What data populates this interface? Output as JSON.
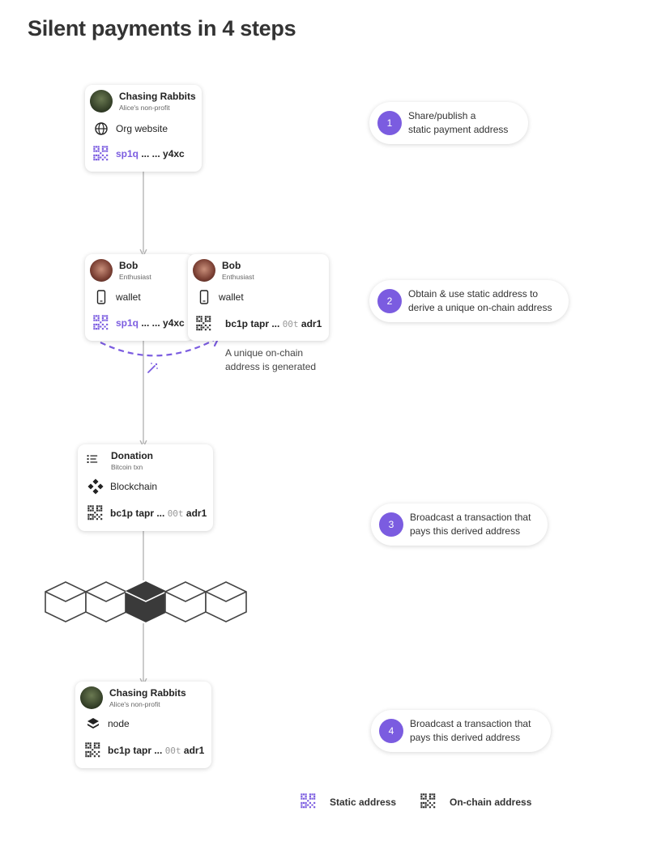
{
  "title": "Silent payments in 4 steps",
  "colors": {
    "accent": "#7b5ce0",
    "onchain": "#333333",
    "line": "#b5b5b5"
  },
  "cards": {
    "alice_top": {
      "name": "Chasing Rabbits",
      "sub": "Alice's non-profit",
      "row1": "Org website",
      "row1_icon": "globe-icon",
      "addr_a": "sp1q",
      "addr_b": " ... ... y4xc"
    },
    "bob_left": {
      "name": "Bob",
      "sub": "Enthusiast",
      "row1": "wallet",
      "row1_icon": "phone-icon",
      "addr_a": "sp1q",
      "addr_b": " ... ... y4xc"
    },
    "bob_right": {
      "name": "Bob",
      "sub": "Enthusiast",
      "row1": "wallet",
      "row1_icon": "phone-icon",
      "addr_a": "bc1p tapr ... ",
      "addr_mono": "00t",
      "addr_c": " adr1"
    },
    "donation": {
      "name": "Donation",
      "sub": "Bitcoin txn",
      "row1": "Blockchain",
      "row1_icon": "blockchain-icon",
      "addr_a": "bc1p tapr ... ",
      "addr_mono": "00t",
      "addr_c": " adr1"
    },
    "alice_bottom": {
      "name": "Chasing Rabbits",
      "sub": "Alice's non-profit",
      "row1": "node",
      "row1_icon": "node-icon",
      "addr_a": "bc1p tapr ... ",
      "addr_mono": "00t",
      "addr_c": " adr1"
    }
  },
  "note": {
    "line1": "A unique on-chain",
    "line2": "address is generated"
  },
  "steps": [
    {
      "num": "1",
      "line1": "Share/publish a",
      "line2": "static payment address"
    },
    {
      "num": "2",
      "line1": "Obtain & use static address to",
      "line2": "derive a unique on-chain address"
    },
    {
      "num": "3",
      "line1": "Broadcast a transaction that",
      "line2": "pays this derived address"
    },
    {
      "num": "4",
      "line1": "Broadcast a transaction that",
      "line2": "pays this derived address"
    }
  ],
  "legend": {
    "static": "Static address",
    "onchain": "On-chain address"
  }
}
